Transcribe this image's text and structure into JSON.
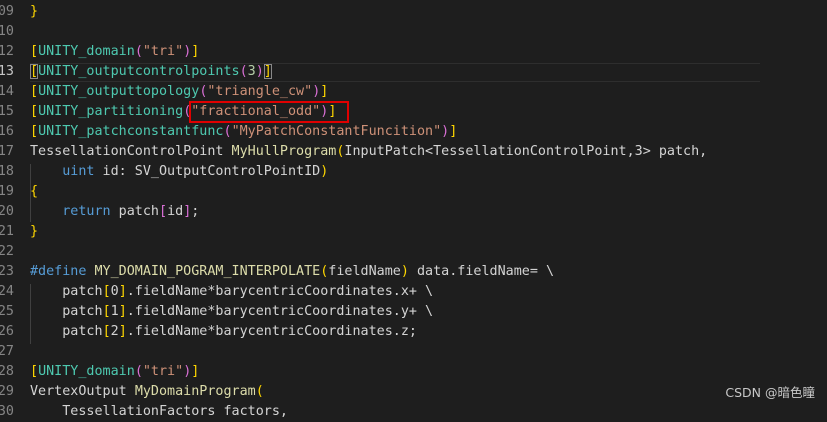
{
  "editor": {
    "lines": [
      {
        "num": "09",
        "tokens": [
          {
            "t": "}",
            "c": "t-bracket1"
          }
        ]
      },
      {
        "num": "10",
        "tokens": []
      },
      {
        "num": "12",
        "tokens": [
          {
            "t": "[",
            "c": "t-bracket1"
          },
          {
            "t": "UNITY_domain",
            "c": "t-type"
          },
          {
            "t": "(",
            "c": "t-bracket2"
          },
          {
            "t": "\"tri\"",
            "c": "t-string"
          },
          {
            "t": ")",
            "c": "t-bracket2"
          },
          {
            "t": "]",
            "c": "t-bracket1"
          }
        ]
      },
      {
        "num": "13",
        "current": true,
        "tokens": [
          {
            "t": "[",
            "c": "t-bracket1 t-bracket-match"
          },
          {
            "t": "UNITY_outputcontrolpoints",
            "c": "t-type"
          },
          {
            "t": "(",
            "c": "t-bracket2"
          },
          {
            "t": "3",
            "c": "t-number"
          },
          {
            "t": ")",
            "c": "t-bracket2"
          },
          {
            "t": "]",
            "c": "t-bracket1 t-bracket-match"
          }
        ]
      },
      {
        "num": "14",
        "tokens": [
          {
            "t": "[",
            "c": "t-bracket1"
          },
          {
            "t": "UNITY_outputtopology",
            "c": "t-type"
          },
          {
            "t": "(",
            "c": "t-bracket2"
          },
          {
            "t": "\"triangle_cw\"",
            "c": "t-string"
          },
          {
            "t": ")",
            "c": "t-bracket2"
          },
          {
            "t": "]",
            "c": "t-bracket1"
          }
        ]
      },
      {
        "num": "15",
        "tokens": [
          {
            "t": "[",
            "c": "t-bracket1"
          },
          {
            "t": "UNITY_partitioning",
            "c": "t-type"
          },
          {
            "t": "(",
            "c": "t-bracket2"
          },
          {
            "t": "\"fractional_odd\"",
            "c": "t-string"
          },
          {
            "t": ")",
            "c": "t-bracket2"
          },
          {
            "t": "]",
            "c": "t-bracket1"
          }
        ]
      },
      {
        "num": "16",
        "tokens": [
          {
            "t": "[",
            "c": "t-bracket1"
          },
          {
            "t": "UNITY_patchconstantfunc",
            "c": "t-type"
          },
          {
            "t": "(",
            "c": "t-bracket2"
          },
          {
            "t": "\"MyPatchConstantFuncition\"",
            "c": "t-string"
          },
          {
            "t": ")",
            "c": "t-bracket2"
          },
          {
            "t": "]",
            "c": "t-bracket1"
          }
        ]
      },
      {
        "num": "17",
        "tokens": [
          {
            "t": "TessellationControlPoint",
            "c": "t-plain"
          },
          {
            "t": " ",
            "c": "t-plain"
          },
          {
            "t": "MyHullProgram",
            "c": "t-func"
          },
          {
            "t": "(",
            "c": "t-bracket1"
          },
          {
            "t": "InputPatch",
            "c": "t-plain"
          },
          {
            "t": "<",
            "c": "t-plain"
          },
          {
            "t": "TessellationControlPoint",
            "c": "t-plain"
          },
          {
            "t": ",3>",
            "c": "t-plain"
          },
          {
            "t": " patch,",
            "c": "t-plain"
          }
        ]
      },
      {
        "num": "18",
        "tokens": [
          {
            "t": "    ",
            "c": "t-plain"
          },
          {
            "t": "uint",
            "c": "t-keyword"
          },
          {
            "t": " id: SV_OutputControlPointID",
            "c": "t-plain"
          },
          {
            "t": ")",
            "c": "t-bracket1"
          }
        ]
      },
      {
        "num": "19",
        "tokens": [
          {
            "t": "{",
            "c": "t-bracket1"
          }
        ]
      },
      {
        "num": "20",
        "tokens": [
          {
            "t": "    ",
            "c": "t-plain"
          },
          {
            "t": "return",
            "c": "t-keyword"
          },
          {
            "t": " patch",
            "c": "t-plain"
          },
          {
            "t": "[",
            "c": "t-bracket2"
          },
          {
            "t": "id",
            "c": "t-plain"
          },
          {
            "t": "]",
            "c": "t-bracket2"
          },
          {
            "t": ";",
            "c": "t-plain"
          }
        ]
      },
      {
        "num": "21",
        "tokens": [
          {
            "t": "}",
            "c": "t-bracket1"
          }
        ]
      },
      {
        "num": "22",
        "tokens": []
      },
      {
        "num": "23",
        "tokens": [
          {
            "t": "#define",
            "c": "t-macro"
          },
          {
            "t": " ",
            "c": "t-plain"
          },
          {
            "t": "MY_DOMAIN_POGRAM_INTERPOLATE",
            "c": "t-func"
          },
          {
            "t": "(",
            "c": "t-bracket1"
          },
          {
            "t": "fieldName",
            "c": "t-plain"
          },
          {
            "t": ")",
            "c": "t-bracket1"
          },
          {
            "t": " data.fieldName= \\",
            "c": "t-plain"
          }
        ]
      },
      {
        "num": "24",
        "tokens": [
          {
            "t": "    patch",
            "c": "t-plain"
          },
          {
            "t": "[",
            "c": "t-bracket1"
          },
          {
            "t": "0",
            "c": "t-plain"
          },
          {
            "t": "]",
            "c": "t-bracket1"
          },
          {
            "t": ".fieldName*barycentricCoordinates.x+ \\",
            "c": "t-plain"
          }
        ]
      },
      {
        "num": "25",
        "tokens": [
          {
            "t": "    patch",
            "c": "t-plain"
          },
          {
            "t": "[",
            "c": "t-bracket1"
          },
          {
            "t": "1",
            "c": "t-plain"
          },
          {
            "t": "]",
            "c": "t-bracket1"
          },
          {
            "t": ".fieldName*barycentricCoordinates.y+ \\",
            "c": "t-plain"
          }
        ]
      },
      {
        "num": "26",
        "tokens": [
          {
            "t": "    patch",
            "c": "t-plain"
          },
          {
            "t": "[",
            "c": "t-bracket1"
          },
          {
            "t": "2",
            "c": "t-plain"
          },
          {
            "t": "]",
            "c": "t-bracket1"
          },
          {
            "t": ".fieldName*barycentricCoordinates.z;",
            "c": "t-plain"
          }
        ]
      },
      {
        "num": "27",
        "tokens": []
      },
      {
        "num": "28",
        "tokens": [
          {
            "t": "[",
            "c": "t-bracket1"
          },
          {
            "t": "UNITY_domain",
            "c": "t-type"
          },
          {
            "t": "(",
            "c": "t-bracket2"
          },
          {
            "t": "\"tri\"",
            "c": "t-string"
          },
          {
            "t": ")",
            "c": "t-bracket2"
          },
          {
            "t": "]",
            "c": "t-bracket1"
          }
        ]
      },
      {
        "num": "29",
        "tokens": [
          {
            "t": "VertexOutput",
            "c": "t-plain"
          },
          {
            "t": " ",
            "c": "t-plain"
          },
          {
            "t": "MyDomainProgram",
            "c": "t-func"
          },
          {
            "t": "(",
            "c": "t-bracket1"
          }
        ]
      },
      {
        "num": "30",
        "tokens": [
          {
            "t": "    TessellationFactors factors,",
            "c": "t-plain"
          }
        ]
      }
    ]
  },
  "annotation": {
    "highlight_target": "\"fractional_odd\")"
  },
  "watermark": {
    "text": "CSDN @暗色瞳"
  }
}
